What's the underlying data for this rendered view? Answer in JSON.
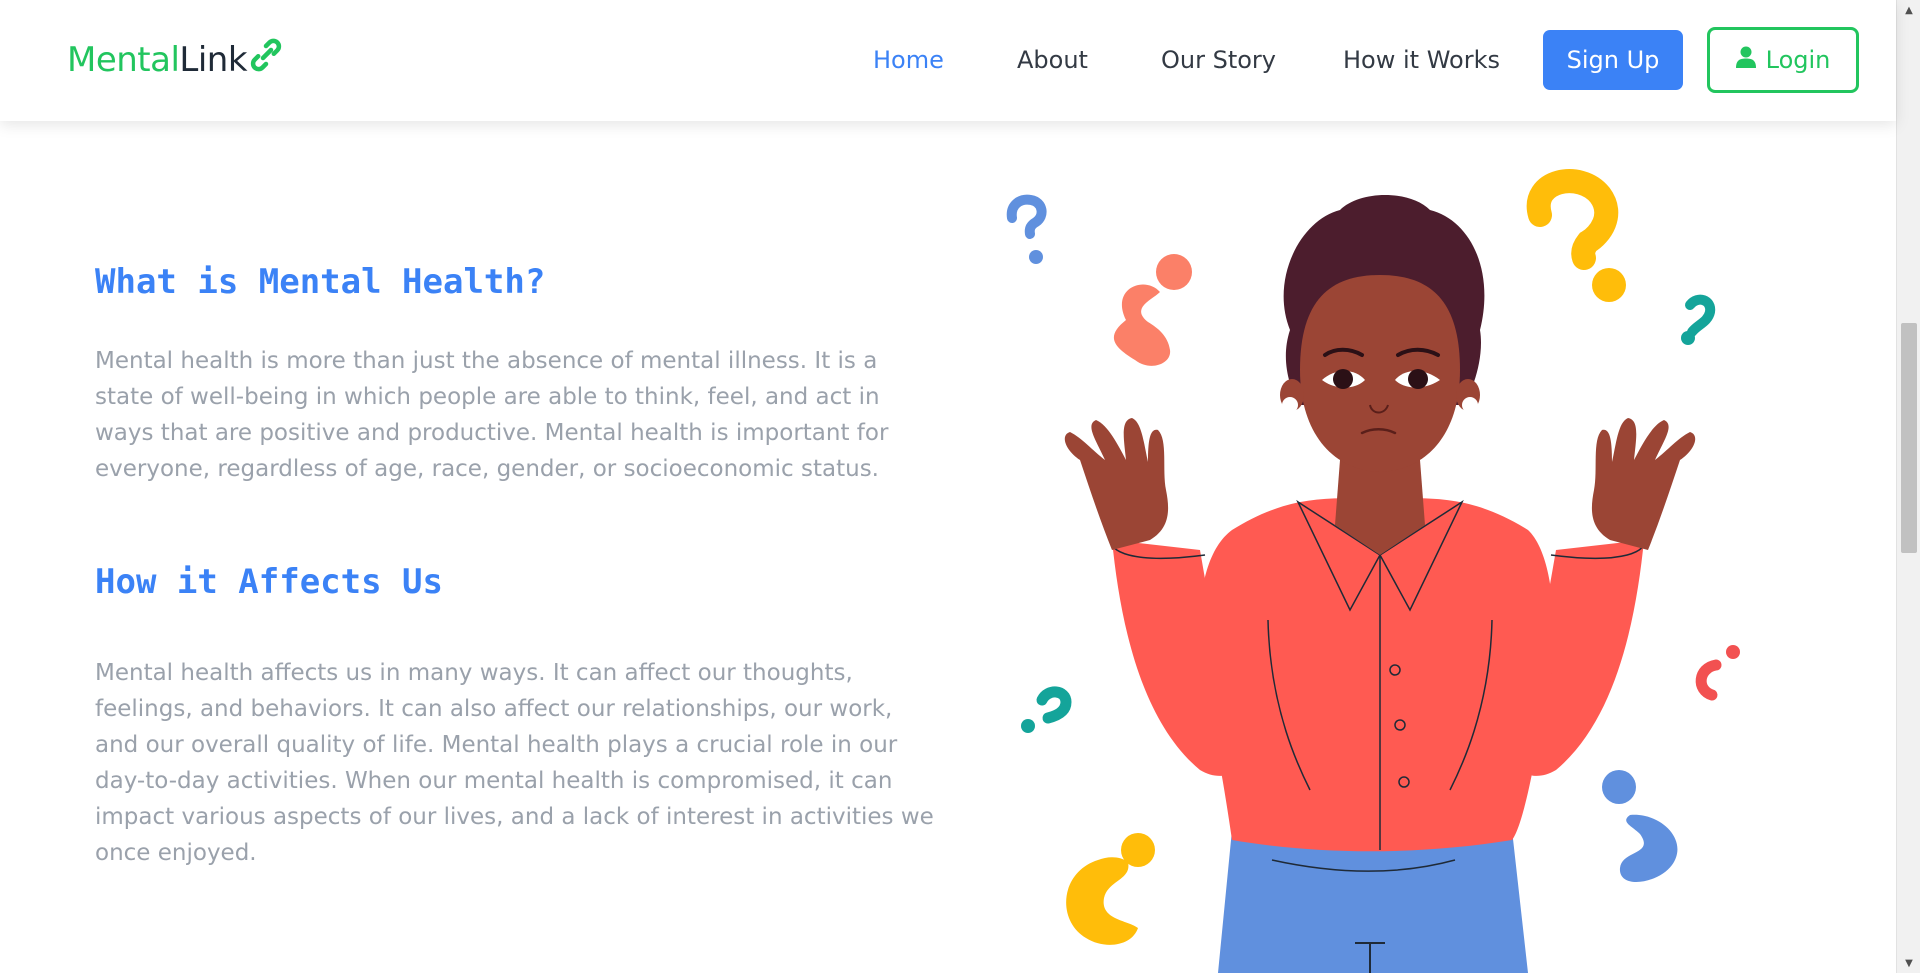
{
  "brand": {
    "name_part1": "Mental",
    "name_part2": "Link",
    "icon": "link-icon",
    "colors": {
      "green": "#22c55e",
      "dark": "#1f2a37"
    }
  },
  "nav": {
    "links": [
      {
        "label": "Home",
        "active": true
      },
      {
        "label": "About",
        "active": false
      },
      {
        "label": "Our Story",
        "active": false
      },
      {
        "label": "How it Works",
        "active": false
      }
    ],
    "signup_label": "Sign Up",
    "login_label": "Login",
    "login_icon": "user-icon"
  },
  "content": {
    "section1": {
      "title": "What is Mental Health?",
      "body": "Mental health is more than just the absence of mental illness. It is a state of well-being in which people are able to think, feel, and act in ways that are positive and productive. Mental health is important for everyone, regardless of age, race, gender, or socioeconomic status."
    },
    "section2": {
      "title": "How it Affects Us",
      "body": "Mental health affects us in many ways. It can affect our thoughts, feelings, and behaviors. It can also affect our relationships, our work, and our overall quality of life. Mental health plays a crucial role in our day-to-day activities. When our mental health is compromised, it can impact various aspects of our lives, and a lack of interest in activities we once enjoyed."
    }
  },
  "illustration": {
    "subject": "confused-person-illustration",
    "colors": {
      "shirt": "#ff5a52",
      "pants": "#6090de",
      "skin": "#9b4535",
      "hair": "#4c1d2d",
      "yellow": "#ffbd0a",
      "salmon": "#fb8068",
      "teal": "#14a49a",
      "blue": "#6090de",
      "red": "#f25151"
    }
  },
  "theme": {
    "accent": "#3b82f6",
    "text_muted": "#9aa1ab"
  }
}
